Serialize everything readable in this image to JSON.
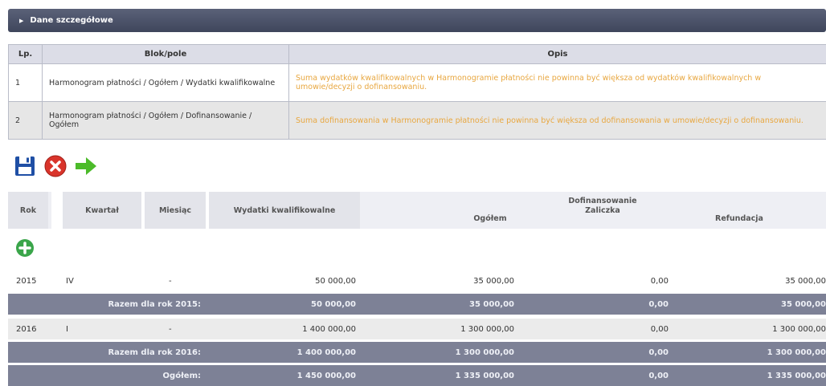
{
  "section": {
    "title": "Dane szczegółowe"
  },
  "errors_table": {
    "headers": {
      "lp": "Lp.",
      "blok": "Blok/pole",
      "opis": "Opis"
    },
    "rows": [
      {
        "lp": "1",
        "blok": "Harmonogram płatności / Ogółem / Wydatki kwalifikowalne",
        "opis": "Suma wydatków kwalifikowalnych w Harmonogramie płatności nie powinna być większa od wydatków kwalifikowalnych w umowie/decyzji o dofinansowaniu."
      },
      {
        "lp": "2",
        "blok": "Harmonogram płatności / Ogółem / Dofinansowanie / Ogółem",
        "opis": "Suma dofinansowania w Harmonogramie płatności nie powinna być większa od dofinansowania w umowie/decyzji o dofinansowaniu."
      }
    ]
  },
  "toolbar": {
    "save_icon": "save-icon",
    "cancel_icon": "cancel-icon",
    "forward_icon": "arrow-right-icon"
  },
  "colors": {
    "save": "#1f4fa5",
    "cancel": "#d9342b",
    "forward": "#4cbb2a",
    "add": "#3aa54a",
    "error_text": "#e8a740",
    "sum_row": "#7d8196"
  },
  "data_table": {
    "headers": {
      "rok": "Rok",
      "kwartal": "Kwartał",
      "miesiac": "Miesiąc",
      "wydatki": "Wydatki kwalifikowalne",
      "dofinansowanie": "Dofinansowanie",
      "ogolem": "Ogółem",
      "zaliczka": "Zaliczka",
      "refundacja": "Refundacja"
    },
    "rows": [
      {
        "rok": "2015",
        "kwartal": "IV",
        "miesiac": "-",
        "wydatki": "50 000,00",
        "ogolem": "35 000,00",
        "zaliczka": "0,00",
        "refundacja": "35 000,00"
      },
      {
        "label": "Razem dla rok 2015:",
        "wydatki": "50 000,00",
        "ogolem": "35 000,00",
        "zaliczka": "0,00",
        "refundacja": "35 000,00"
      },
      {
        "rok": "2016",
        "kwartal": "I",
        "miesiac": "-",
        "wydatki": "1 400 000,00",
        "ogolem": "1 300 000,00",
        "zaliczka": "0,00",
        "refundacja": "1 300 000,00"
      },
      {
        "label": "Razem dla rok 2016:",
        "wydatki": "1 400 000,00",
        "ogolem": "1 300 000,00",
        "zaliczka": "0,00",
        "refundacja": "1 300 000,00"
      },
      {
        "label": "Ogółem:",
        "wydatki": "1 450 000,00",
        "ogolem": "1 335 000,00",
        "zaliczka": "0,00",
        "refundacja": "1 335 000,00"
      }
    ]
  }
}
